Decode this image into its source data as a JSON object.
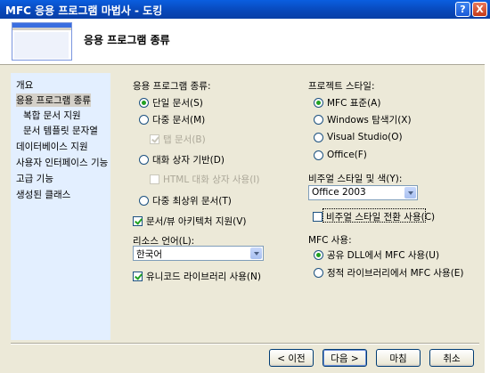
{
  "window": {
    "title": "MFC 응용 프로그램 마법사 - 도킹",
    "help_glyph": "?",
    "close_glyph": "X"
  },
  "header": {
    "title": "응용 프로그램 종류"
  },
  "sidebar": {
    "items": [
      {
        "label": "개요"
      },
      {
        "label": "응용 프로그램 종류"
      },
      {
        "label": "복합 문서 지원"
      },
      {
        "label": "문서 템플릿 문자열"
      },
      {
        "label": "데이터베이스 지원"
      },
      {
        "label": "사용자 인터페이스 기능"
      },
      {
        "label": "고급 기능"
      },
      {
        "label": "생성된 클래스"
      }
    ]
  },
  "app_type": {
    "label": "응용 프로그램 종류:",
    "single": "단일 문서(S)",
    "multi": "다중 문서(M)",
    "tabbed": "탭 문서(B)",
    "dialog": "대화 상자 기반(D)",
    "html_dialog": "HTML 대화 상자 사용(I)",
    "multi_toplevel": "다중 최상위 문서(T)",
    "selected": "단일 문서(S)"
  },
  "docview": {
    "label": "문서/뷰 아키텍처 지원(V)",
    "checked": true
  },
  "resource_lang": {
    "label": "리소스 언어(L):",
    "value": "한국어"
  },
  "unicode": {
    "label": "유니코드 라이브러리 사용(N)",
    "checked": true
  },
  "project_style": {
    "label": "프로젝트 스타일:",
    "mfc_standard": "MFC 표준(A)",
    "windows_explorer": "Windows 탐색기(X)",
    "visual_studio": "Visual Studio(O)",
    "office": "Office(F)",
    "selected": "MFC 표준(A)"
  },
  "visual_style": {
    "label": "비주얼 스타일 및 색(Y):",
    "value": "Office 2003"
  },
  "style_switch": {
    "label": "비주얼 스타일 전환 사용(C)",
    "checked": false
  },
  "mfc_use": {
    "label": "MFC 사용:",
    "shared_dll": "공유 DLL에서 MFC 사용(U)",
    "static_lib": "정적 라이브러리에서 MFC 사용(E)",
    "selected": "공유 DLL에서 MFC 사용(U)"
  },
  "buttons": {
    "prev": "< 이전",
    "next": "다음 >",
    "finish": "마침",
    "cancel": "취소"
  }
}
